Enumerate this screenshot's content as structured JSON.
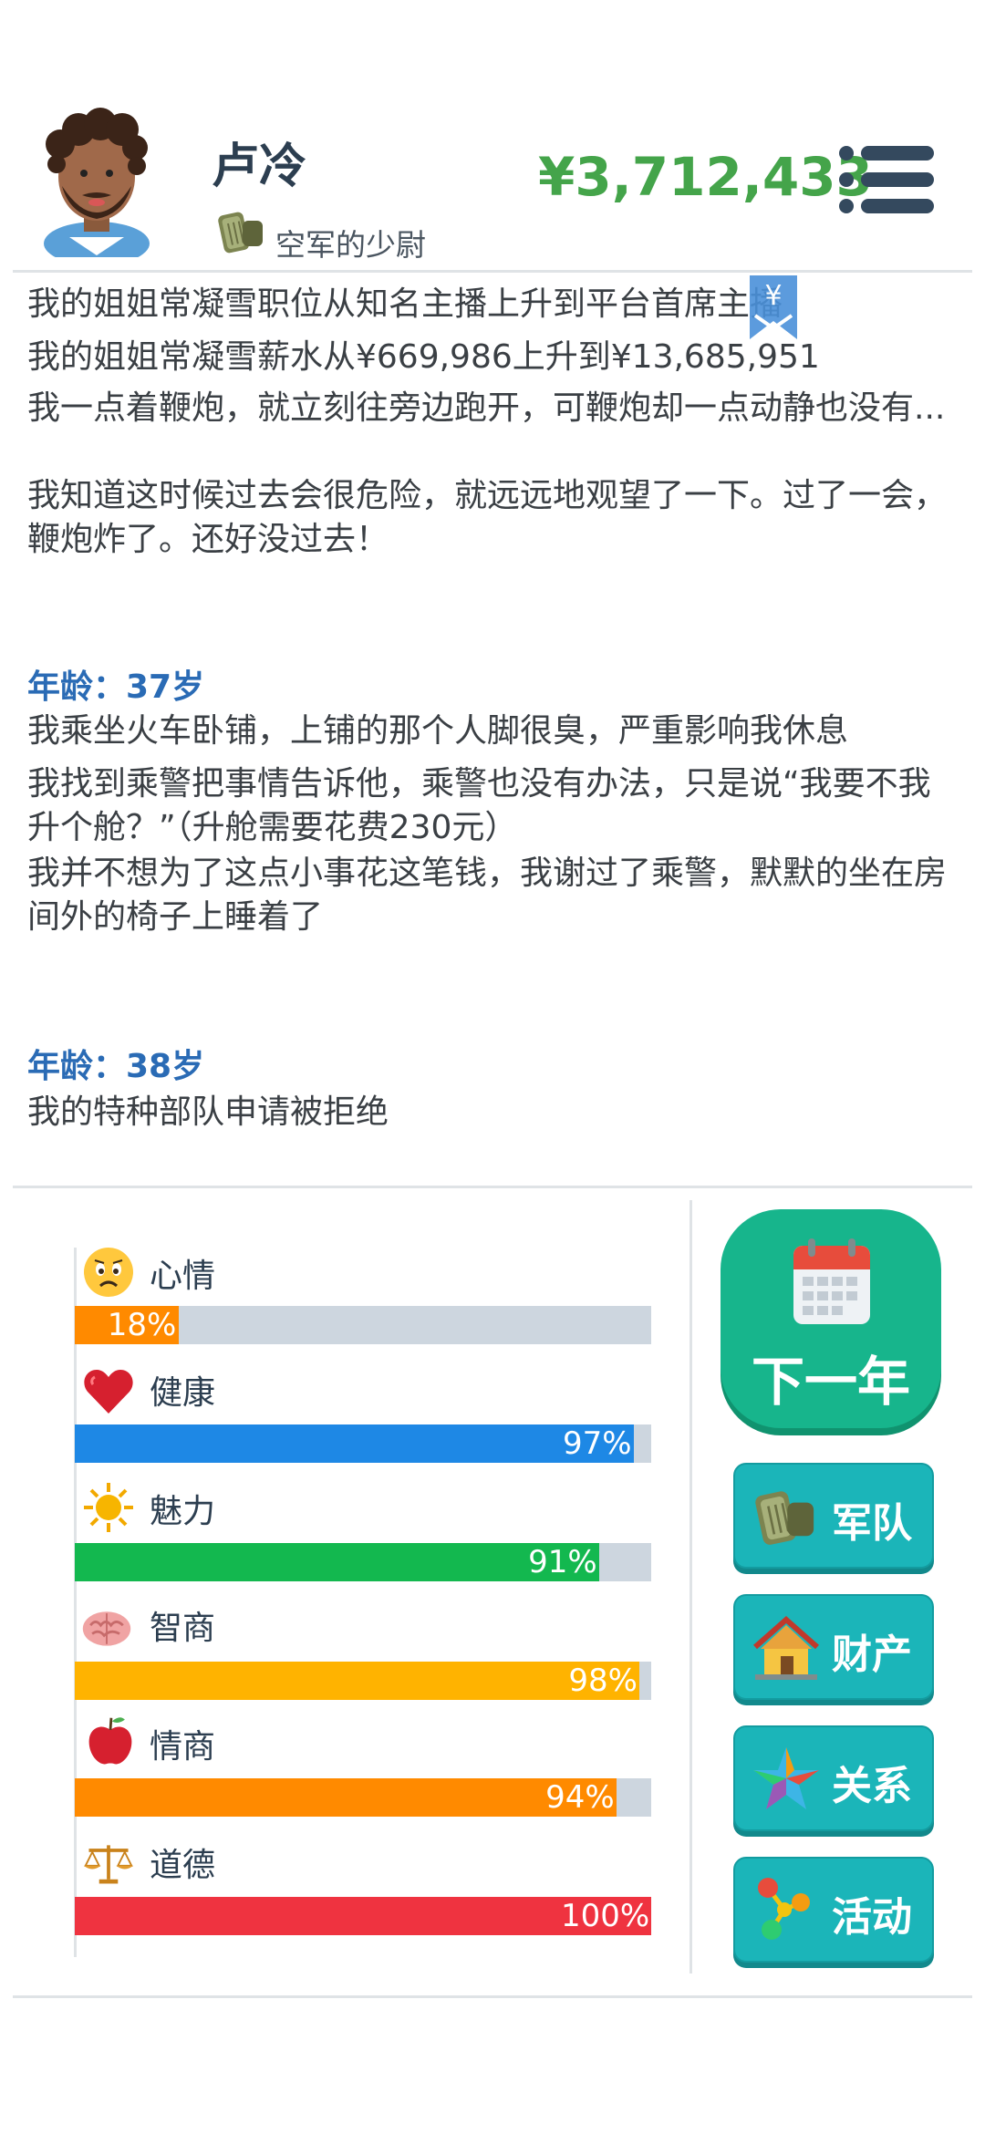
{
  "header": {
    "player_name": "卢冷",
    "rank": "空军的少尉",
    "money": "¥3,712,433",
    "avatar_icon": "male-avatar-icon",
    "rank_icon": "military-rank-icon",
    "menu_icon": "hamburger-menu-icon"
  },
  "log": {
    "bookmark_symbol": "¥",
    "lines": [
      "我的姐姐常凝雪职位从知名主播上升到平台首席主播",
      "我的姐姐常凝雪薪水从¥669,986上升到¥13,685,951",
      "我一点着鞭炮，就立刻往旁边跑开，可鞭炮却一点动静也没有...",
      "我知道这时候过去会很危险，就远远地观望了一下。过了一会，鞭炮炸了。还好没过去！"
    ],
    "age37": "年龄：37岁",
    "lines37": [
      "我乘坐火车卧铺，上铺的那个人脚很臭，严重影响我休息",
      "我找到乘警把事情告诉他，乘警也没有办法，只是说“我要不我升个舱？”（升舱需要花费230元）",
      "我并不想为了这点小事花这笔钱，我谢过了乘警，默默的坐在房间外的椅子上睡着了"
    ],
    "age38": "年龄：38岁",
    "lines38": [
      "我的特种部队申请被拒绝"
    ]
  },
  "stats": [
    {
      "label": "心情",
      "value": 18,
      "pct": "18%",
      "color": "#ff8a00",
      "icon": "sad-face-icon"
    },
    {
      "label": "健康",
      "value": 97,
      "pct": "97%",
      "color": "#1e88e5",
      "icon": "heart-icon"
    },
    {
      "label": "魅力",
      "value": 91,
      "pct": "91%",
      "color": "#13b84f",
      "icon": "sun-icon"
    },
    {
      "label": "智商",
      "value": 98,
      "pct": "98%",
      "color": "#ffb300",
      "icon": "brain-icon"
    },
    {
      "label": "情商",
      "value": 94,
      "pct": "94%",
      "color": "#ff8a00",
      "icon": "apple-icon"
    },
    {
      "label": "道德",
      "value": 100,
      "pct": "100%",
      "color": "#ef3340",
      "icon": "scales-icon"
    }
  ],
  "actions": {
    "next_year": "下一年",
    "army": "军队",
    "property": "财产",
    "relations": "关系",
    "activities": "活动"
  }
}
